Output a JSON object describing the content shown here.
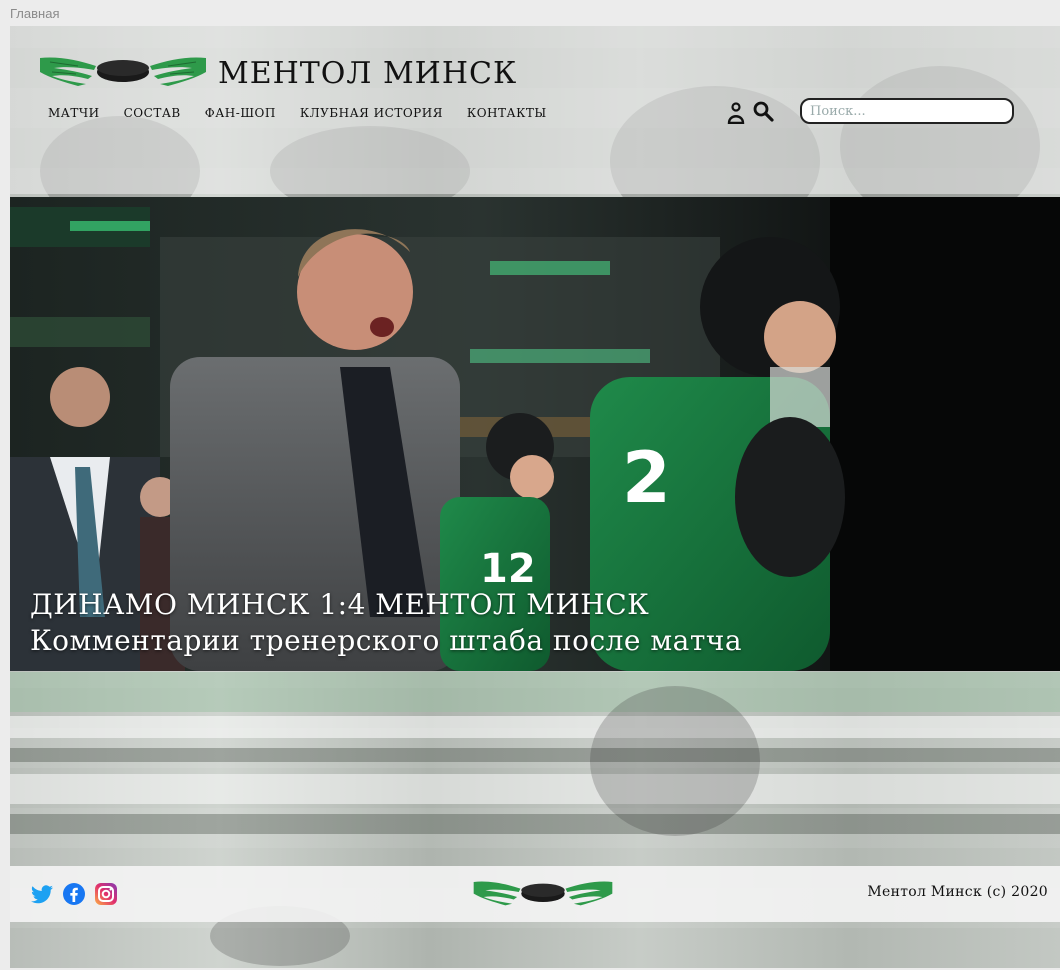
{
  "window": {
    "tab_title": "Главная"
  },
  "header": {
    "brand_name": "МЕНТОЛ МИНСК",
    "nav": [
      {
        "label": "МАТЧИ"
      },
      {
        "label": "СОСТАВ"
      },
      {
        "label": "ФАН-ШОП"
      },
      {
        "label": "КЛУБНАЯ ИСТОРИЯ"
      },
      {
        "label": "КОНТАКТЫ"
      }
    ],
    "search": {
      "placeholder": "Поиск...",
      "value": ""
    },
    "icons": {
      "user": "user-icon",
      "search": "search-icon"
    }
  },
  "hero": {
    "title": "ДИНАМО МИНСК 1:4 МЕНТОЛ МИНСК",
    "subtitle": "Комментарии тренерского штаба после матча"
  },
  "footer": {
    "social": [
      "twitter-icon",
      "facebook-icon",
      "instagram-icon"
    ],
    "copyright": "Ментол Минск (c) 2020"
  },
  "colors": {
    "brand_green": "#2e9a4a",
    "puck": "#1a1a1a",
    "twitter": "#1da1f2",
    "facebook": "#1877f2",
    "instagram": "#d6249f"
  }
}
